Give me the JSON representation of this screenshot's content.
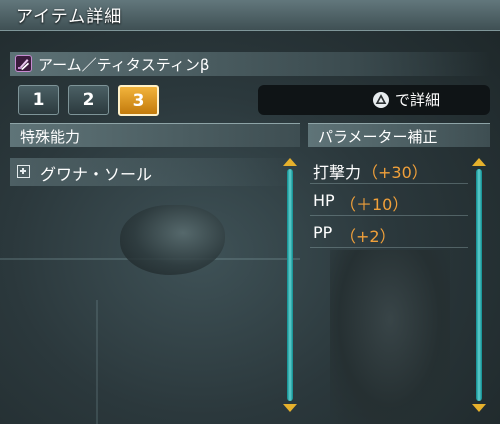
{
  "window": {
    "title": "アイテム詳細"
  },
  "item": {
    "icon": "twin-daggers-icon",
    "name": "アーム／ティタスティンβ"
  },
  "tabs": [
    {
      "label": "1",
      "active": false
    },
    {
      "label": "2",
      "active": false
    },
    {
      "label": "3",
      "active": true
    }
  ],
  "detail_button": {
    "icon": "triangle-button-icon",
    "label": "で詳細"
  },
  "sections": {
    "abilities": {
      "title": "特殊能力"
    },
    "parameters": {
      "title": "パラメーター補正"
    }
  },
  "abilities": [
    {
      "icon": "expand-plus-icon",
      "label": "グワナ・ソール"
    }
  ],
  "parameters": [
    {
      "name": "打撃力",
      "value": "（+30）"
    },
    {
      "name": "HP",
      "value": "（＋10）"
    },
    {
      "name": "PP",
      "value": "（+2）"
    }
  ],
  "colors": {
    "accent_tab": "#e49a1f",
    "bonus_value": "#f0a03a",
    "scrollbar": "#3fb7b8",
    "scroll_arrow": "#e6b12c"
  }
}
